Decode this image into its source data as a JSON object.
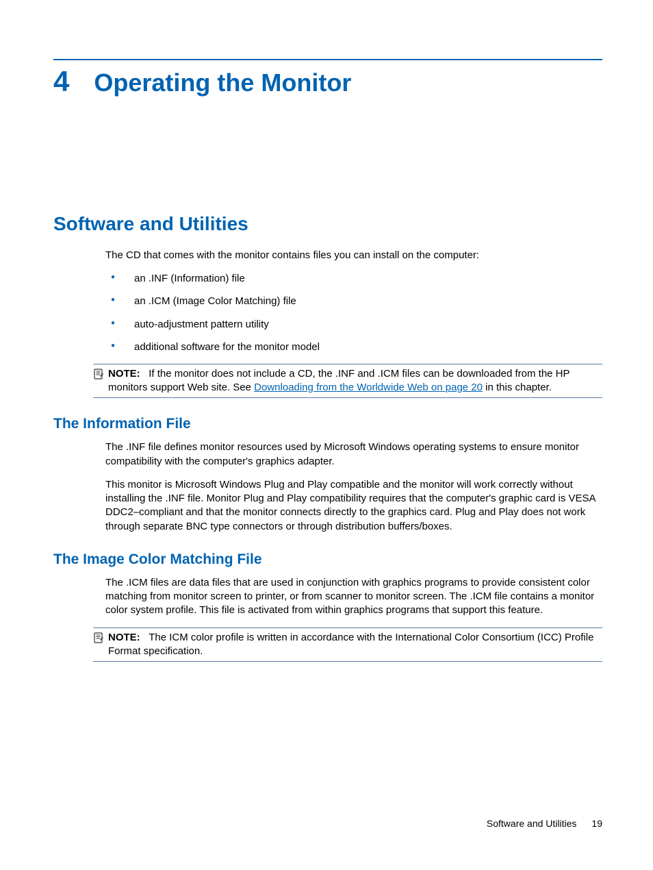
{
  "chapter": {
    "number": "4",
    "title": "Operating the Monitor"
  },
  "section1": {
    "heading": "Software and Utilities",
    "intro": "The CD that comes with the monitor contains files you can install on the computer:",
    "bullets": [
      "an .INF (Information) file",
      "an .ICM (Image Color Matching) file",
      "auto-adjustment pattern utility",
      "additional software for the monitor model"
    ],
    "note": {
      "label": "NOTE:",
      "before_link": "If the monitor does not include a CD, the .INF and .ICM files can be downloaded from the HP monitors support Web site. See ",
      "link_text": "Downloading from the Worldwide Web on page 20",
      "after_link": " in this chapter."
    }
  },
  "section2": {
    "heading": "The Information File",
    "p1": "The .INF file defines monitor resources used by Microsoft Windows operating systems to ensure monitor compatibility with the computer's graphics adapter.",
    "p2": "This monitor is Microsoft Windows Plug and Play compatible and the monitor will work correctly without installing the .INF file. Monitor Plug and Play compatibility requires that the computer's graphic card is VESA DDC2–compliant and that the monitor connects directly to the graphics card. Plug and Play does not work through separate BNC type connectors or through distribution buffers/boxes."
  },
  "section3": {
    "heading": "The Image Color Matching File",
    "p1": "The .ICM files are data files that are used in conjunction with graphics programs to provide consistent color matching from monitor screen to printer, or from scanner to monitor screen. The .ICM file contains a monitor color system profile. This file is activated from within graphics programs that support this feature.",
    "note": {
      "label": "NOTE:",
      "text": "The ICM color profile is written in accordance with the International Color Consortium (ICC) Profile Format specification."
    }
  },
  "footer": {
    "section": "Software and Utilities",
    "page": "19"
  }
}
